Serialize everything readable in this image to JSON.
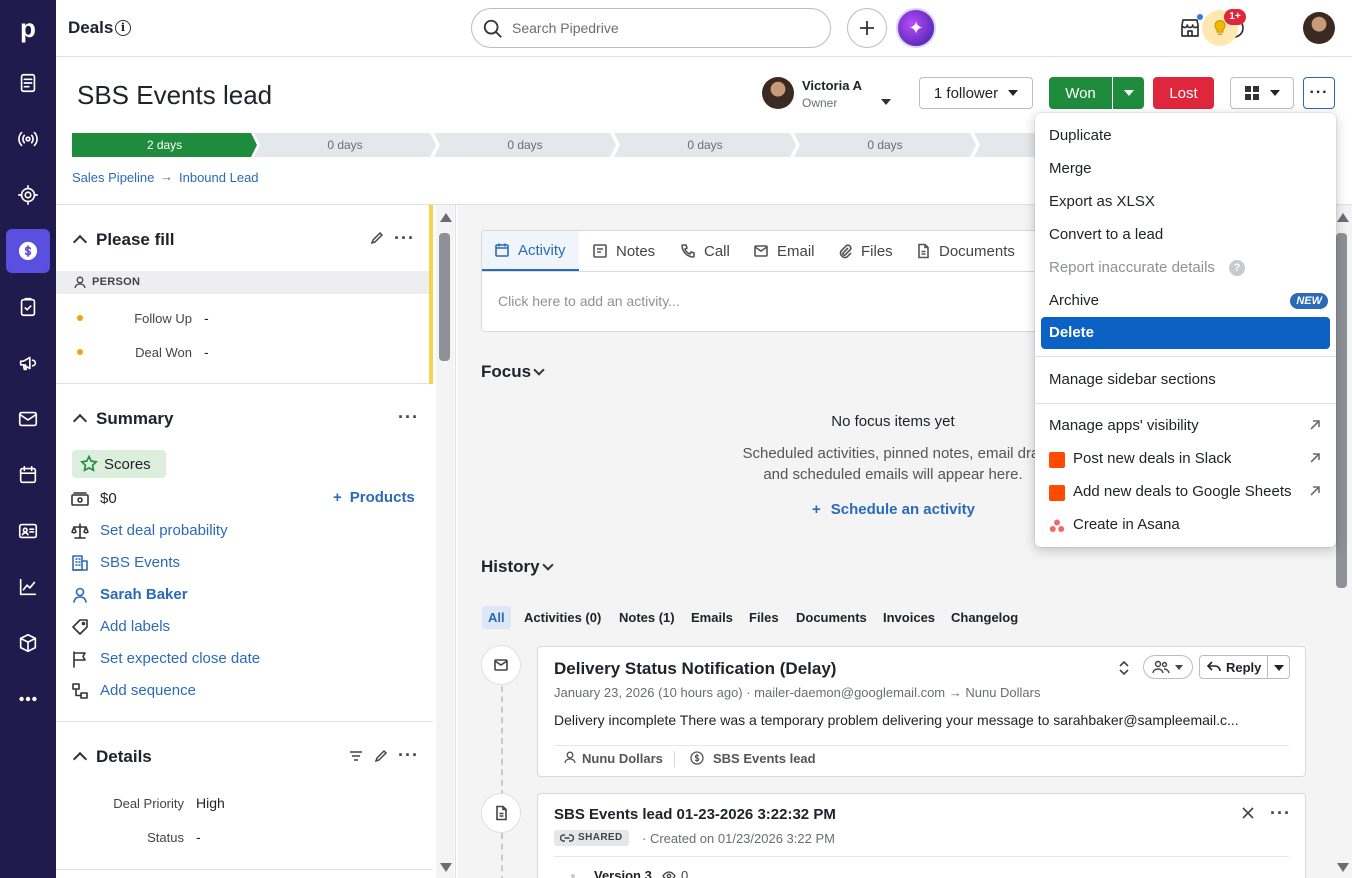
{
  "app": {
    "logo_letter": "p",
    "page_title": "Deals",
    "search_placeholder": "Search Pipedrive",
    "notification_count": "1+"
  },
  "deal": {
    "title": "SBS Events lead",
    "owner_name": "Victoria A",
    "owner_role": "Owner",
    "follower_label": "1 follower",
    "won_label": "Won",
    "lost_label": "Lost"
  },
  "pipeline": {
    "stages": [
      "2 days",
      "0 days",
      "0 days",
      "0 days",
      "0 days"
    ],
    "breadcrumb": [
      "Sales Pipeline",
      "Inbound Lead"
    ],
    "arrow": "→"
  },
  "please_fill": {
    "title": "Please fill",
    "person_label": "PERSON",
    "fields": [
      {
        "label": "Follow Up",
        "value": "-"
      },
      {
        "label": "Deal Won",
        "value": "-"
      }
    ]
  },
  "summary": {
    "title": "Summary",
    "scores_label": "Scores",
    "value": "$0",
    "products_label": "Products",
    "probability_label": "Set deal probability",
    "org_name": "SBS Events",
    "person_name": "Sarah Baker",
    "labels_label": "Add labels",
    "close_date_label": "Set expected close date",
    "sequence_label": "Add sequence"
  },
  "details": {
    "title": "Details",
    "fields": [
      {
        "label": "Deal Priority",
        "value": "High"
      },
      {
        "label": "Status",
        "value": "-"
      }
    ]
  },
  "tabs": [
    "Activity",
    "Notes",
    "Call",
    "Email",
    "Files",
    "Documents"
  ],
  "activity_placeholder": "Click here to add an activity...",
  "focus": {
    "title": "Focus",
    "empty_title": "No focus items yet",
    "empty_line1": "Scheduled activities, pinned notes, email draf",
    "empty_line2": "and scheduled emails will appear here.",
    "schedule_label": "Schedule an activity"
  },
  "history": {
    "title": "History",
    "filters": [
      "All",
      "Activities (0)",
      "Notes (1)",
      "Emails",
      "Files",
      "Documents",
      "Invoices",
      "Changelog"
    ],
    "email": {
      "subject": "Delivery Status Notification (Delay)",
      "meta": "January 23, 2026 (10 hours ago) · mailer-daemon@googlemail.com → Nunu Dollars",
      "snippet": "Delivery incomplete There was a temporary problem delivering your message to sarahbaker@sampleemail.c...",
      "person_chip": "Nunu Dollars",
      "deal_chip": "SBS Events lead",
      "reply_label": "Reply"
    },
    "note": {
      "title": "SBS Events lead 01-23-2026 3:22:32 PM",
      "shared_label": "SHARED",
      "created": "· Created on 01/23/2026 3:22 PM",
      "version": "Version 3",
      "count": "0"
    }
  },
  "menu": {
    "items": [
      {
        "label": "Duplicate"
      },
      {
        "label": "Merge"
      },
      {
        "label": "Export as XLSX"
      },
      {
        "label": "Convert to a lead"
      },
      {
        "label": "Report inaccurate details"
      },
      {
        "label": "Archive",
        "badge": "NEW"
      },
      {
        "label": "Delete"
      },
      {
        "label": "Manage sidebar sections"
      },
      {
        "label": "Manage apps' visibility"
      },
      {
        "label": "Post new deals in Slack"
      },
      {
        "label": "Add new deals to Google Sheets"
      },
      {
        "label": "Create in Asana"
      }
    ]
  },
  "colors": {
    "sidebar": "#1f1b4d",
    "won": "#1e8b3d",
    "lost": "#e0263c",
    "accent": "#2a6ab8",
    "menu_selected": "#0b62c4"
  }
}
